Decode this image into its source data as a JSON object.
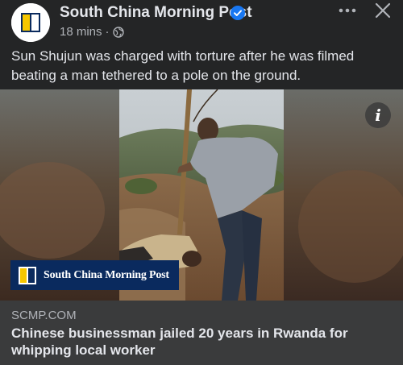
{
  "post": {
    "page_name": "South China Morning Post",
    "time": "18 mins",
    "separator": "·",
    "privacy_icon": "globe-icon",
    "verified_icon": "verified-badge-icon",
    "more_icon": "more-options-icon",
    "close_icon": "close-icon",
    "caption": "Sun Shujun was charged with torture after he was filmed beating a man tethered to a pole on the ground."
  },
  "media": {
    "info_icon_text": "i",
    "logo_text": "South China Morning Post"
  },
  "link": {
    "domain": "SCMP.COM",
    "title": "Chinese businessman jailed 20 years in Rwanda for whipping local worker"
  },
  "colors": {
    "background": "#242526",
    "link_background": "#3a3b3c",
    "verified_blue": "#1877f2",
    "brand_navy": "#0a2a5e",
    "brand_yellow": "#f6c700"
  }
}
